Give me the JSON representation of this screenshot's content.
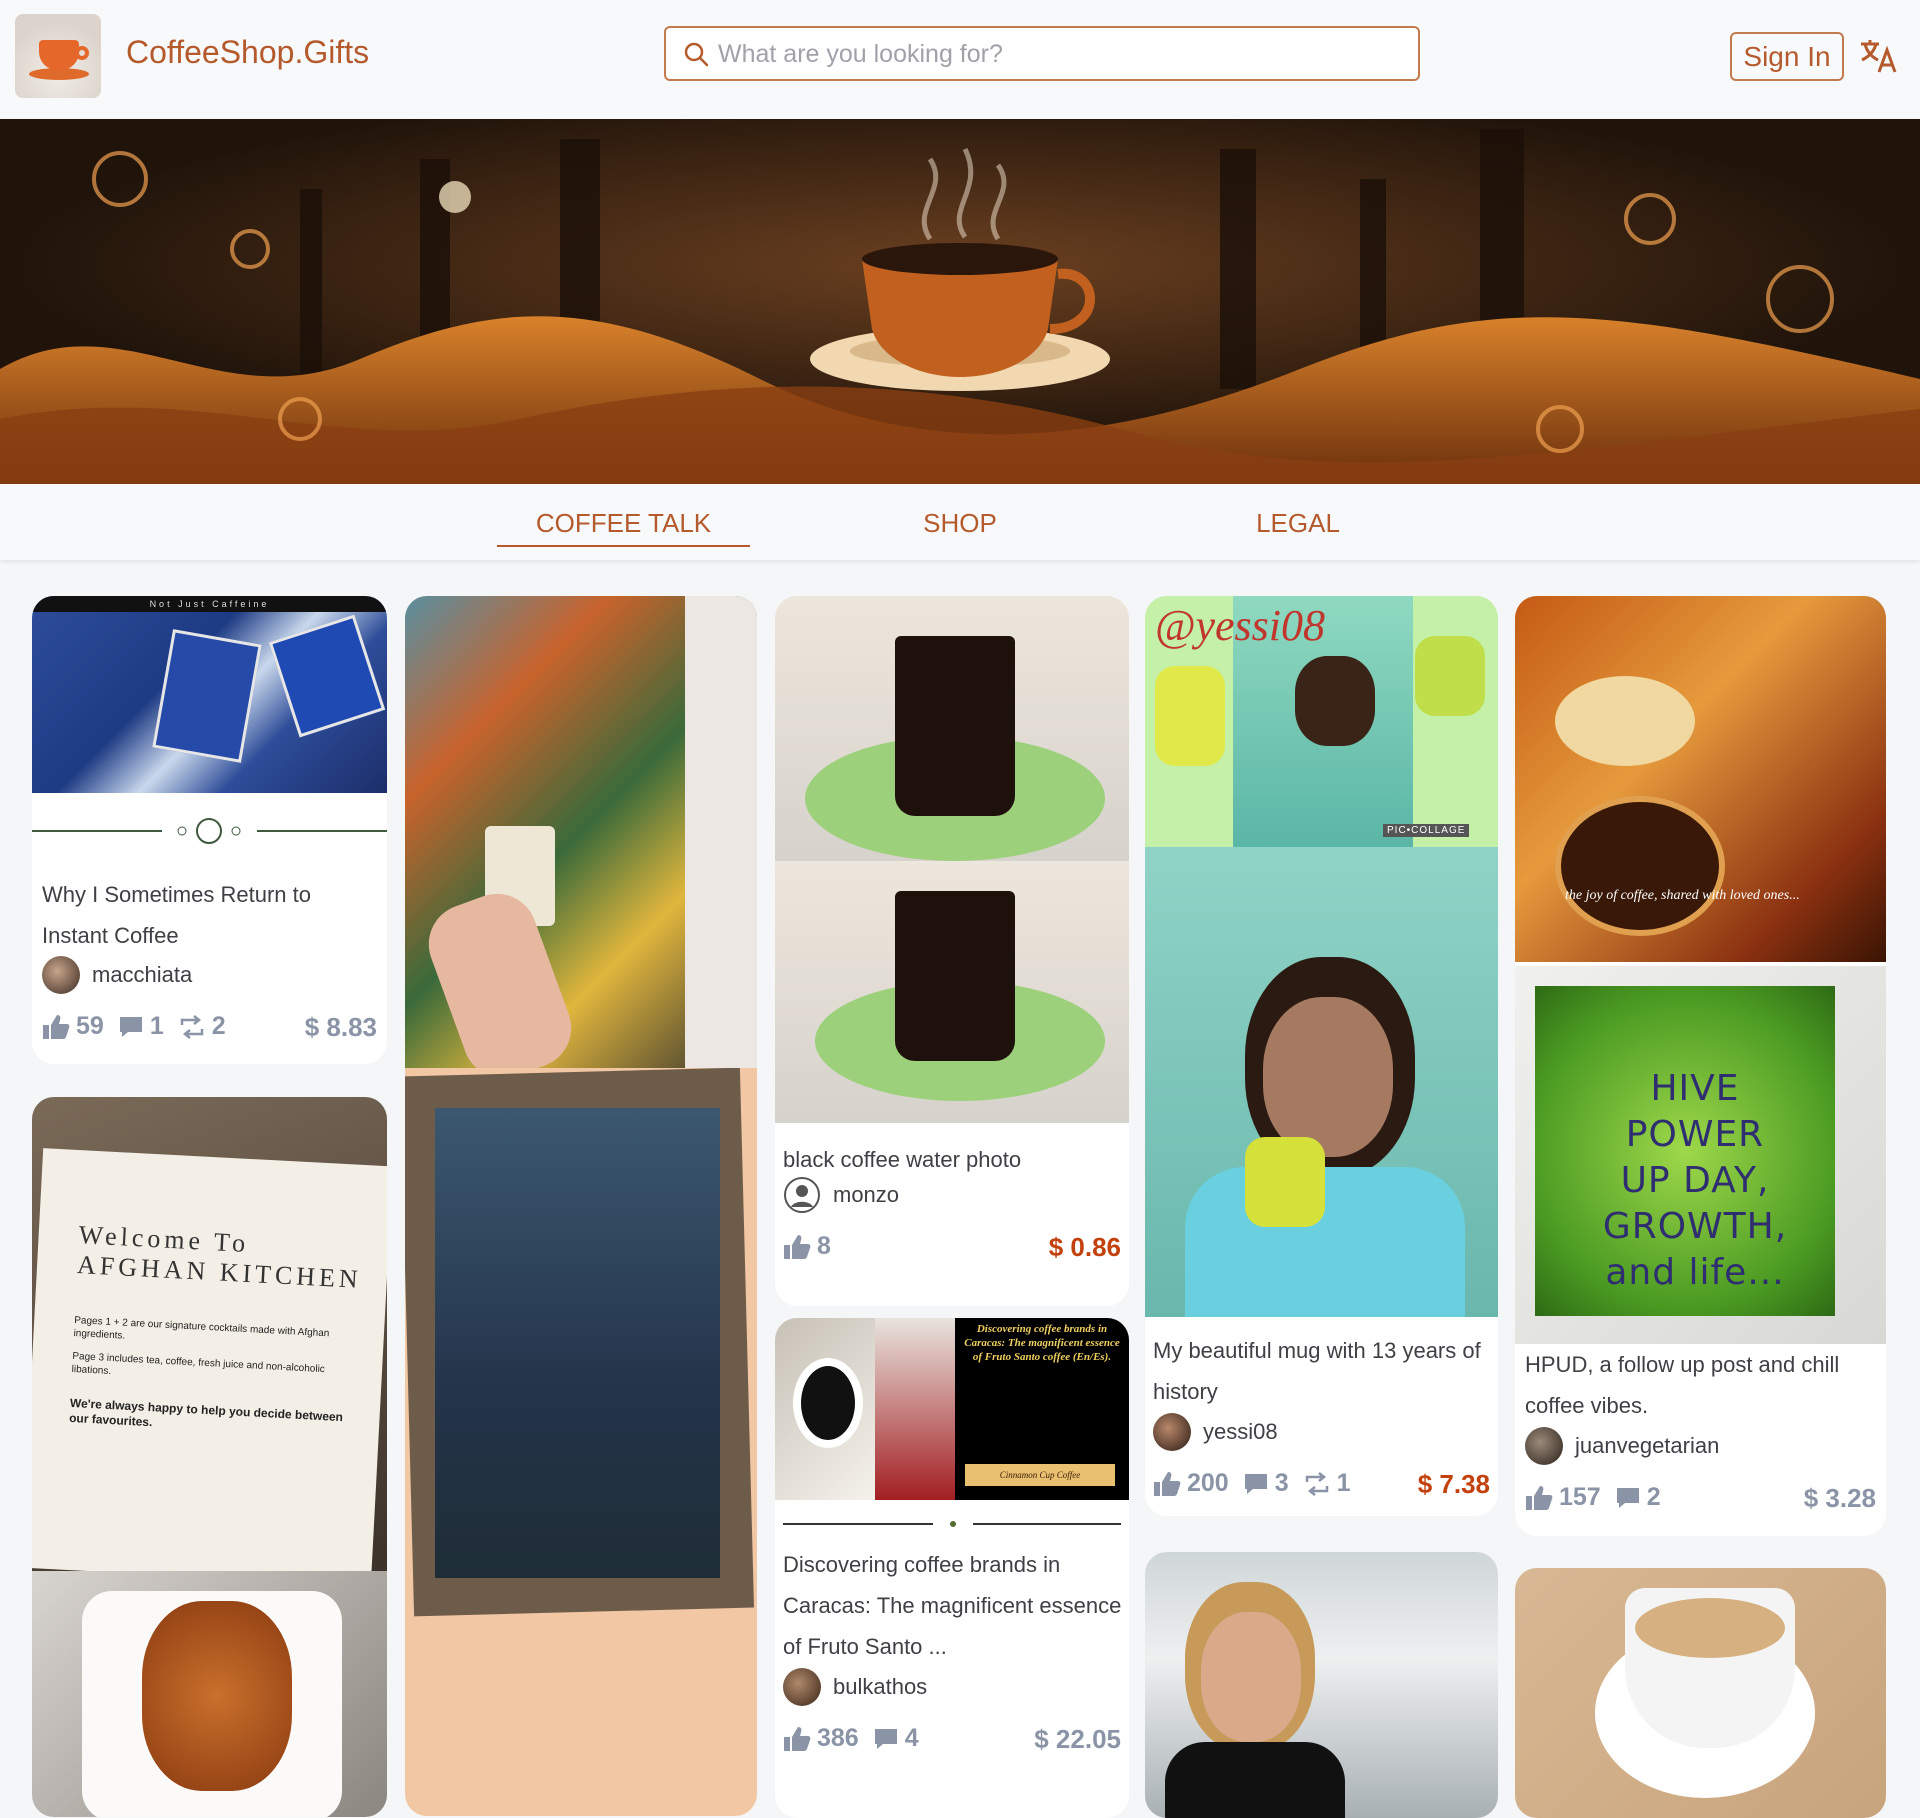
{
  "header": {
    "brand": "CoffeeShop.Gifts",
    "search_placeholder": "What are you looking for?",
    "signin": "Sign In"
  },
  "nav": {
    "tabs": [
      {
        "label": "COFFEE TALK",
        "active": true
      },
      {
        "label": "SHOP",
        "active": false
      },
      {
        "label": "LEGAL",
        "active": false
      }
    ]
  },
  "colors": {
    "accent": "#b45a2d",
    "price_highlight": "#c2410c",
    "price_muted": "#8a94a6"
  },
  "posts": [
    {
      "title": "Why I Sometimes Return to Instant Coffee",
      "author": "macchiata",
      "upvotes": "59",
      "comments": "1",
      "reblogs": "2",
      "price": "$ 8.83",
      "photo_text": "Not Just Caffeine"
    },
    {
      "title": "black coffee water photo",
      "author": "monzo",
      "upvotes": "8",
      "price": "$ 0.86"
    },
    {
      "title": "My beautiful mug with 13 years of history",
      "author": "yessi08",
      "upvotes": "200",
      "comments": "3",
      "reblogs": "1",
      "price": "$ 7.38",
      "photo_text": "@yessi08",
      "photo_badge": "PIC•COLLAGE"
    },
    {
      "title": "HPUD, a follow up post and chill coffee vibes.",
      "author": "juanvegetarian",
      "upvotes": "157",
      "comments": "2",
      "price": "$ 3.28",
      "photo_caption": "the joy of coffee, shared with loved ones...",
      "photo_text": "HIVE POWER UP DAY, GROWTH, and life..."
    },
    {
      "title": "Discovering coffee brands in Caracas: The magnificent essence of Fruto Santo ...",
      "author": "bulkathos",
      "upvotes": "386",
      "comments": "4",
      "price": "$ 22.05",
      "photo_text": "Discovering coffee brands in Caracas: The magnificent essence of Fruto Santo coffee (En/Es).",
      "photo_label": "Cinnamon Cup Coffee"
    },
    {
      "title": "",
      "author": "",
      "photo_text": "Welcome To AFGHAN KITCHEN",
      "photo_lines": [
        "Pages 1 + 2 are our signature cocktails made with Afghan ingredients.",
        "Page 3 includes tea, coffee, fresh juice and non-alcoholic libations.",
        "We're always happy to help you decide between our favourites."
      ]
    }
  ]
}
